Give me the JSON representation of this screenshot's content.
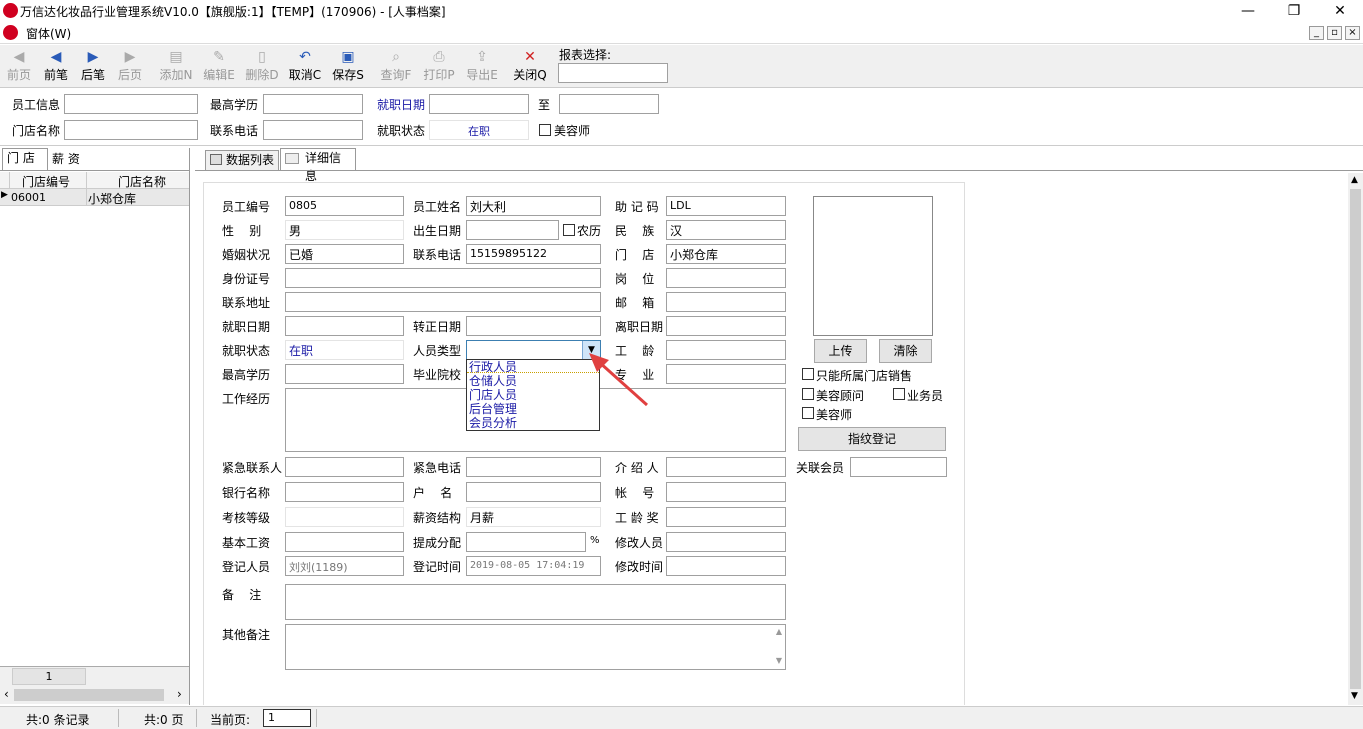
{
  "window": {
    "title": "万信达化妆品行业管理系统V10.0【旗舰版:1】【TEMP】(170906) - [人事档案]",
    "menu": "窗体(W)",
    "controls": [
      "—",
      "❐",
      "✕"
    ],
    "mdi_controls": [
      "_",
      "▫",
      "×"
    ]
  },
  "toolbar": {
    "buttons": [
      {
        "label": "前页",
        "icon": "◀",
        "enabled": false
      },
      {
        "label": "前笔",
        "icon": "◀",
        "enabled": true
      },
      {
        "label": "后笔",
        "icon": "▶",
        "enabled": true
      },
      {
        "label": "后页",
        "icon": "▶",
        "enabled": false
      },
      {
        "label": "添加N",
        "icon": "📄",
        "enabled": false
      },
      {
        "label": "编辑E",
        "icon": "✎",
        "enabled": false
      },
      {
        "label": "删除D",
        "icon": "🗋",
        "enabled": false
      },
      {
        "label": "取消C",
        "icon": "↶",
        "enabled": true
      },
      {
        "label": "保存S",
        "icon": "💾",
        "enabled": true
      },
      {
        "label": "查询F",
        "icon": "🔍",
        "enabled": false
      },
      {
        "label": "打印P",
        "icon": "⎙",
        "enabled": false
      },
      {
        "label": "导出E",
        "icon": "⇪",
        "enabled": false
      },
      {
        "label": "关闭Q",
        "icon": "✕",
        "enabled": true
      }
    ],
    "report_label": "报表选择:",
    "report_value": ""
  },
  "filter": {
    "employee_info_label": "员工信息",
    "employee_info": "",
    "education_label": "最高学历",
    "education": "",
    "hire_date_label": "就职日期",
    "hire_date_from": "",
    "to_label": "至",
    "hire_date_to": "",
    "store_name_label": "门店名称",
    "store_name": "",
    "phone_label": "联系电话",
    "phone": "",
    "status_label": "就职状态",
    "status": "在职",
    "beautician_label": "美容师"
  },
  "left_panel": {
    "tabs": [
      "门 店",
      "薪 资"
    ],
    "columns": [
      "门店编号",
      "门店名称"
    ],
    "rows": [
      {
        "code": "06001",
        "name": "小郑仓库"
      }
    ],
    "page_num": "1"
  },
  "right_panel": {
    "tabs": [
      "数据列表",
      "详细信息"
    ]
  },
  "form": {
    "emp_no_label": "员工编号",
    "emp_no": "0805",
    "emp_name_label": "员工姓名",
    "emp_name": "刘大利",
    "mnemonic_label": "助 记 码",
    "mnemonic": "LDL",
    "gender_label": "性    别",
    "gender": "男",
    "birth_label": "出生日期",
    "birth": "",
    "lunar_label": "农历",
    "ethnic_label": "民    族",
    "ethnic": "汉",
    "marital_label": "婚姻状况",
    "marital": "已婚",
    "phone_label": "联系电话",
    "phone": "15159895122",
    "store_label": "门    店",
    "store": "小郑仓库",
    "id_label": "身份证号",
    "id": "",
    "post_label": "岗    位",
    "post": "",
    "address_label": "联系地址",
    "address": "",
    "email_label": "邮    箱",
    "email": "",
    "hire_label": "就职日期",
    "hire": "",
    "regular_label": "转正日期",
    "regular": "",
    "leave_label": "离职日期",
    "leave": "",
    "status_label": "就职状态",
    "status": "在职",
    "type_label": "人员类型",
    "type": "",
    "seniority_label": "工    龄",
    "seniority": "",
    "edu_label": "最高学历",
    "edu": "",
    "school_label": "毕业院校",
    "major_label": "专    业",
    "major": "",
    "work_label": "工作经历",
    "emerg_contact_label": "紧急联系人",
    "emerg_contact": "",
    "emerg_phone_label": "紧急电话",
    "emerg_phone": "",
    "referrer_label": "介 绍 人",
    "referrer": "",
    "bank_label": "银行名称",
    "bank": "",
    "acct_name_label": "户    名",
    "acct_name": "",
    "acct_no_label": "帐    号",
    "acct_no": "",
    "grade_label": "考核等级",
    "grade": "",
    "salary_struct_label": "薪资结构",
    "salary_struct": "月薪",
    "seniority_bonus_label": "工 龄 奖",
    "seniority_bonus": "",
    "base_salary_label": "基本工资",
    "base_salary": "",
    "commission_label": "提成分配",
    "commission": "",
    "percent": "%",
    "modifier_label": "修改人员",
    "modifier": "",
    "registrar_label": "登记人员",
    "registrar": "刘刘(1189)",
    "reg_time_label": "登记时间",
    "reg_time": "2019-08-05 17:04:19",
    "mod_time_label": "修改时间",
    "mod_time": "",
    "remark_label": "备    注",
    "other_remark_label": "其他备注",
    "dropdown_options": [
      "行政人员",
      "仓储人员",
      "门店人员",
      "后台管理",
      "会员分析"
    ],
    "upload": "上传",
    "clear": "清除",
    "only_own_store": "只能所属门店销售",
    "beauty_consultant": "美容顾问",
    "salesman": "业务员",
    "beautician": "美容师",
    "fingerprint": "指纹登记",
    "linked_member_label": "关联会员",
    "linked_member": ""
  },
  "status_bar": {
    "records": "共:0 条记录",
    "pages": "共:0 页",
    "current_label": "当前页:",
    "current": "1"
  },
  "colors": {
    "accent": "#d00020",
    "link": "#1a1aa6",
    "arrow": "#e04040"
  }
}
